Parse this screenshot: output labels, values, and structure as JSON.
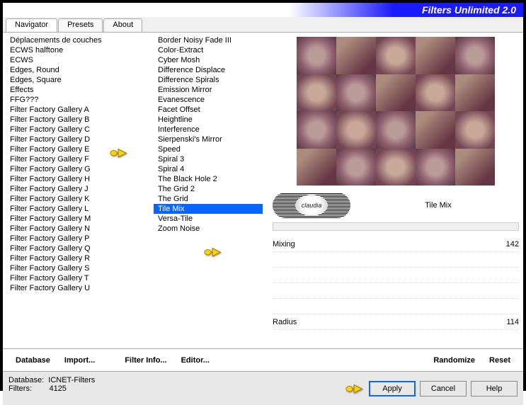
{
  "title": "Filters Unlimited 2.0",
  "tabs": [
    "Navigator",
    "Presets",
    "About"
  ],
  "active_tab": 0,
  "categories": [
    "Déplacements de couches",
    "ECWS halftone",
    "ECWS",
    "Edges, Round",
    "Edges, Square",
    "Effects",
    "FFG???",
    "Filter Factory Gallery A",
    "Filter Factory Gallery B",
    "Filter Factory Gallery C",
    "Filter Factory Gallery D",
    "Filter Factory Gallery E",
    "Filter Factory Gallery F",
    "Filter Factory Gallery G",
    "Filter Factory Gallery H",
    "Filter Factory Gallery J",
    "Filter Factory Gallery K",
    "Filter Factory Gallery L",
    "Filter Factory Gallery M",
    "Filter Factory Gallery N",
    "Filter Factory Gallery P",
    "Filter Factory Gallery Q",
    "Filter Factory Gallery R",
    "Filter Factory Gallery S",
    "Filter Factory Gallery T",
    "Filter Factory Gallery U"
  ],
  "filters_list": [
    "Border Noisy Fade III",
    "Color-Extract",
    "Cyber Mosh",
    "Difference Displace",
    "Difference Spirals",
    "Emission Mirror",
    "Evanescence",
    "Facet Offset",
    "Heightline",
    "Interference",
    "Sierpenski's Mirror",
    "Speed",
    "Spiral 3",
    "Spiral 4",
    "The Black Hole 2",
    "The Grid 2",
    "The Grid",
    "Tile Mix",
    "Versa-Tile",
    "Zoom Noise"
  ],
  "selected_filter_index": 17,
  "badge_label": "claudia",
  "filter_title": "Tile Mix",
  "params": [
    {
      "label": "Mixing",
      "value": "142"
    },
    {
      "label": "",
      "value": ""
    },
    {
      "label": "",
      "value": ""
    },
    {
      "label": "",
      "value": ""
    },
    {
      "label": "",
      "value": ""
    },
    {
      "label": "Radius",
      "value": "114"
    }
  ],
  "toolbar": {
    "database": "Database",
    "import": "Import...",
    "filter_info": "Filter Info...",
    "editor": "Editor...",
    "randomize": "Randomize",
    "reset": "Reset"
  },
  "status": {
    "db_label": "Database:",
    "db_value": "ICNET-Filters",
    "filters_label": "Filters:",
    "filters_value": "4125"
  },
  "buttons": {
    "apply": "Apply",
    "cancel": "Cancel",
    "help": "Help"
  }
}
